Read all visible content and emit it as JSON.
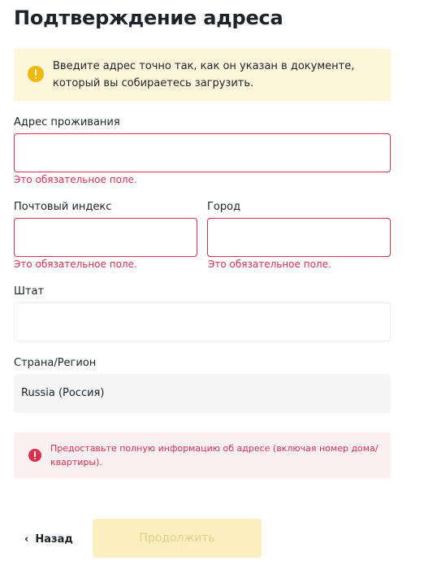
{
  "page": {
    "title": "Подтверждение адреса"
  },
  "notice": {
    "icon": "warning-icon",
    "text_line1": "Введите адрес точно так, как он указан в документе,",
    "text_line2": "который вы собираетесь загрузить."
  },
  "form": {
    "residential_address": {
      "label": "Адрес проживания",
      "value": "",
      "error": "Это обязательное поле."
    },
    "postal_code": {
      "label": "Почтовый индекс",
      "value": "",
      "error": "Это обязательное поле."
    },
    "city": {
      "label": "Город",
      "value": "",
      "error": "Это обязательное поле."
    },
    "state": {
      "label": "Штат",
      "value": ""
    },
    "country": {
      "label": "Страна/Регион",
      "selected": "Russia (Россия)"
    }
  },
  "alert": {
    "icon": "error-icon",
    "text_line1": "Предоставьте полную информацию об адресе (включая номер дома/",
    "text_line2": "квартиры)."
  },
  "actions": {
    "back_icon": "chevron-left-icon",
    "back_label": "Назад",
    "continue_label": "Продолжить",
    "continue_enabled": false
  },
  "colors": {
    "error": "#d9304e",
    "warning_bg": "#fdf6db",
    "warning_icon": "#f0b90b",
    "alert_bg": "#fdf0f2",
    "primary_disabled_bg": "#fcefbf",
    "primary_disabled_text": "#e3cf8e"
  }
}
